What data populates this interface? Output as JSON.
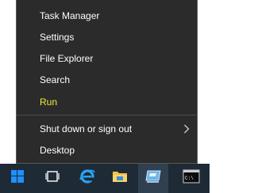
{
  "menu": {
    "items": [
      {
        "label": "Task Manager"
      },
      {
        "label": "Settings"
      },
      {
        "label": "File Explorer"
      },
      {
        "label": "Search"
      },
      {
        "label": "Run"
      },
      {
        "label": "Shut down or sign out"
      },
      {
        "label": "Desktop"
      }
    ],
    "highlight_color": "#f2ee3a",
    "background_color": "#2b2b2b"
  },
  "taskbar": {
    "icons": [
      "windows-start-icon",
      "task-view-icon",
      "internet-explorer-icon",
      "file-explorer-icon",
      "server-manager-icon",
      "command-prompt-icon"
    ],
    "background_color": "#1e2a36"
  }
}
